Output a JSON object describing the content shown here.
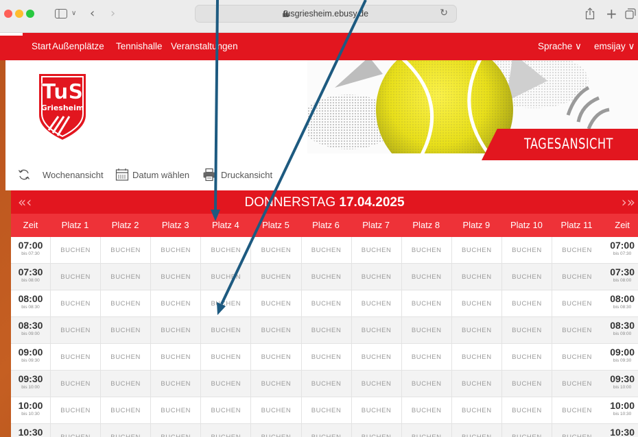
{
  "browser": {
    "url": "tusgriesheim.ebusy.de",
    "icons": [
      "sidebar-icon",
      "chevron-down-icon",
      "back-icon",
      "forward-icon",
      "lock-icon",
      "reload-icon",
      "share-icon",
      "plus-icon",
      "tabs-icon"
    ]
  },
  "nav": {
    "start": "Start",
    "aussen": "Außenplätze",
    "halle": "Tennishalle",
    "veranstaltungen": "Veranstaltungen",
    "sprache": "Sprache ∨",
    "user": "emsijay ∨"
  },
  "header": {
    "logo_text_top": "TuS",
    "logo_text_bottom": "Griesheim",
    "view_title": "TAGESANSICHT"
  },
  "toolbar": {
    "week": "Wochenansicht",
    "date": "Datum wählen",
    "print": "Druckansicht"
  },
  "day": {
    "prev": "«‹",
    "next": "›»",
    "name": "DONNERSTAG",
    "date": "17.04.2025"
  },
  "grid": {
    "time_header": "Zeit",
    "courts": [
      "Platz 1",
      "Platz 2",
      "Platz 3",
      "Platz 4",
      "Platz 5",
      "Platz 6",
      "Platz 7",
      "Platz 8",
      "Platz 9",
      "Platz 10",
      "Platz 11"
    ],
    "book_label": "BUCHEN",
    "rows": [
      {
        "time": "07:00",
        "until": "bis 07:30"
      },
      {
        "time": "07:30",
        "until": "bis 08:00"
      },
      {
        "time": "08:00",
        "until": "bis 08:30"
      },
      {
        "time": "08:30",
        "until": "bis 09:00"
      },
      {
        "time": "09:00",
        "until": "bis 09:30"
      },
      {
        "time": "09:30",
        "until": "bis 10:00"
      },
      {
        "time": "10:00",
        "until": "bis 10:30"
      },
      {
        "time": "10:30",
        "until": ""
      }
    ]
  },
  "colors": {
    "brand_red": "#e2161f",
    "header_red": "#ee3238",
    "arrow_blue": "#1d5a80",
    "background_orange": "#b8531d"
  }
}
